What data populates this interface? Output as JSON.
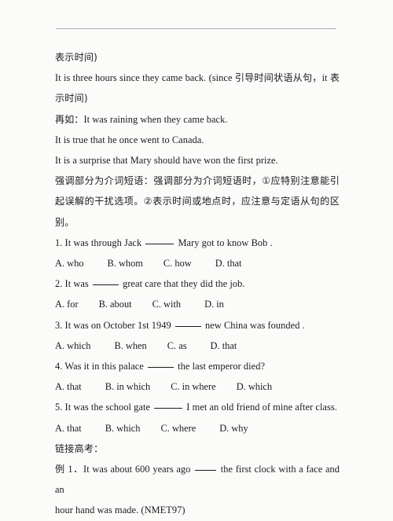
{
  "page": {
    "background_color": "#fbfcfa",
    "text_color": "#1b1b1b",
    "rule_color": "#a9a9b0"
  },
  "content": {
    "line_1": "表示时间)",
    "line_2_pre": "It is three hours since they came back. (since ",
    "line_2_han": "引导时间状语从句，",
    "line_2_mid": "it ",
    "line_2_han2": "表",
    "line_3": "示时间)",
    "line_4_han": "再如：",
    "line_4_en": "It was raining when they came back.",
    "line_5": "It is true that he once went to Canada.",
    "line_6": "It is a surprise that Mary should have won the first prize.",
    "line_7": "强调部分为介词短语：强调部分为介词短语时，①应特别注意能引",
    "line_8": "起误解的干扰选项。②表示时间或地点时，应注意与定语从句的区",
    "line_9": "别。",
    "q1_pre": "1. It was through Jack ",
    "q1_post": " Mary got to know Bob .",
    "q1_options": [
      "A. who",
      "B. whom",
      "C. how",
      "D. that"
    ],
    "q2_pre": "2. It was ",
    "q2_post": " great care that they did the job.",
    "q2_options": [
      "A. for",
      "B. about",
      "C. with",
      "D. in"
    ],
    "q3_pre": "3. It was on October 1st 1949 ",
    "q3_post": " new China was founded .",
    "q3_options": [
      "A. which",
      "B. when",
      "C. as",
      "D. that"
    ],
    "q4_pre": "4. Was it in this palace ",
    "q4_post": " the last emperor died?",
    "q4_options": [
      "A. that",
      "B. in which",
      "C. in where",
      "D. which"
    ],
    "q5_pre": "5. It was the school gate ",
    "q5_post": " I met an old friend of mine after class.",
    "q5_options": [
      "A. that",
      "B. which",
      "C. where",
      "D. why"
    ],
    "section_heading": "链接高考：",
    "example_han": "例",
    "example_pre": " 1．It was about 600 years ago ",
    "example_post": " the first clock with a face and an",
    "example_line2": "hour hand was made. (NMET97)"
  }
}
